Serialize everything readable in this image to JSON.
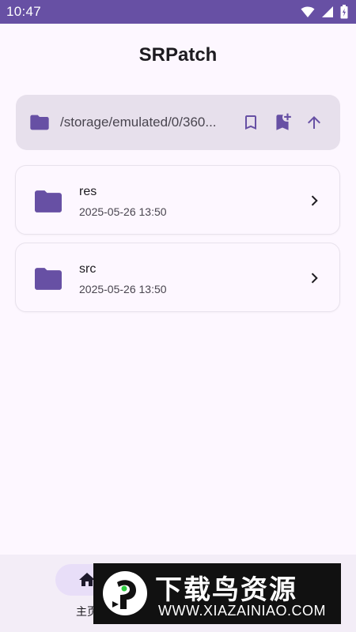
{
  "status_bar": {
    "time": "10:47",
    "icons": [
      "wifi-icon",
      "cellular-signal-icon",
      "battery-icon"
    ]
  },
  "app": {
    "title": "SRPatch"
  },
  "path_bar": {
    "path": "/storage/emulated/0/360...",
    "actions": [
      "bookmark-icon",
      "bookmark-add-icon",
      "arrow-up-icon"
    ]
  },
  "files": [
    {
      "name": "res",
      "date": "2025-05-26 13:50",
      "icon": "folder-icon"
    },
    {
      "name": "src",
      "date": "2025-05-26 13:50",
      "icon": "folder-icon"
    }
  ],
  "bottom_nav": {
    "items": [
      {
        "label": "主页",
        "icon": "home-icon",
        "active": true
      }
    ]
  },
  "watermark": {
    "title": "下载鸟资源",
    "url": "WWW.XIAZAINIAO.COM"
  },
  "colors": {
    "primary": "#6750a4",
    "background": "#fdf7ff",
    "surface_variant": "#e7e0ec",
    "nav_background": "#f3edf7",
    "active_indicator": "#e8def8"
  }
}
